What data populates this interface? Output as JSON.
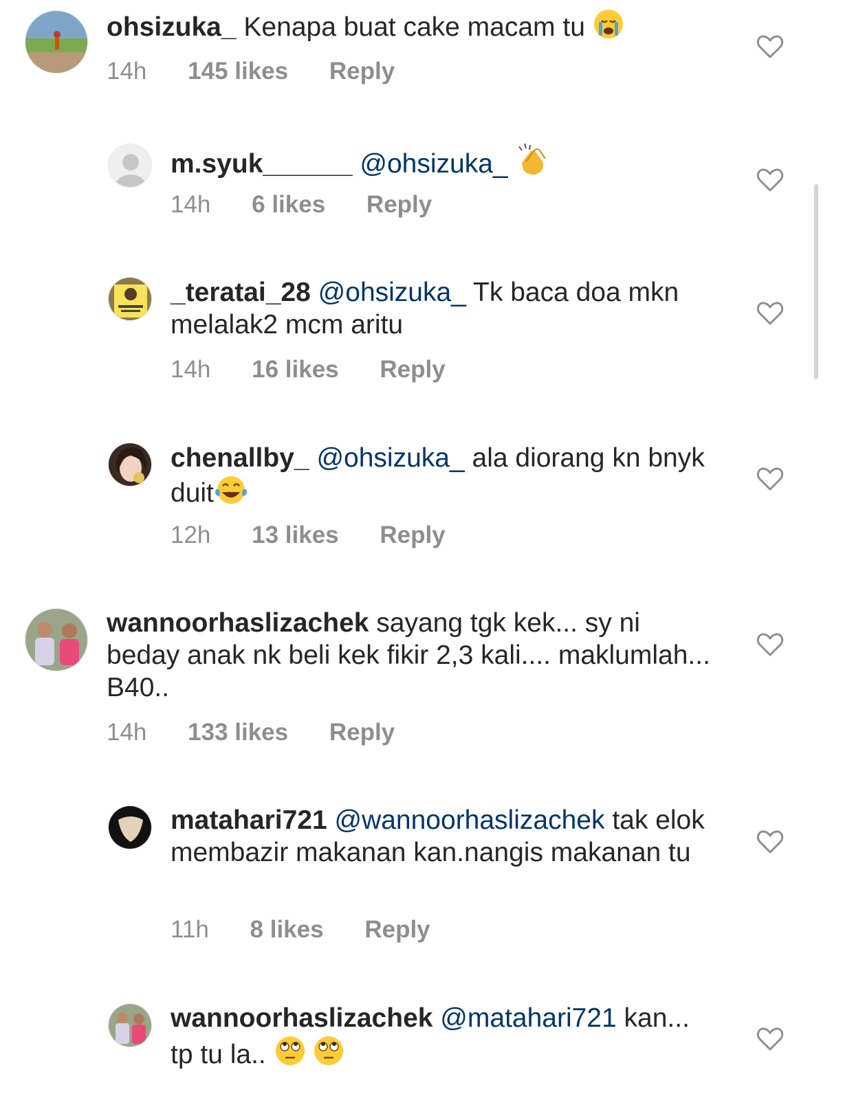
{
  "comments": [
    {
      "user": "ohsizuka_",
      "mention": "",
      "text": "Kenapa buat cake macam tu",
      "emoji": "crying-emoji",
      "time": "14h",
      "likes": "145 likes",
      "reply": "Reply"
    },
    {
      "user": "m.syuk______",
      "mention": "@ohsizuka_",
      "text": "",
      "emoji": "clapping-hands-emoji",
      "time": "14h",
      "likes": "6 likes",
      "reply": "Reply"
    },
    {
      "user": "_teratai_28",
      "mention": "@ohsizuka_",
      "text": "Tk baca doa mkn melalak2 mcm aritu",
      "emoji": "",
      "time": "14h",
      "likes": "16 likes",
      "reply": "Reply"
    },
    {
      "user": "chenallby_",
      "mention": "@ohsizuka_",
      "text": "ala diorang kn bnyk duit",
      "emoji": "tears-of-joy-emoji",
      "time": "12h",
      "likes": "13 likes",
      "reply": "Reply"
    },
    {
      "user": "wannoorhaslizachek",
      "mention": "",
      "text": "sayang tgk kek... sy ni beday anak nk beli kek fikir 2,3 kali.... maklumlah... B40..",
      "emoji": "",
      "time": "14h",
      "likes": "133 likes",
      "reply": "Reply"
    },
    {
      "user": "matahari721",
      "mention": "@wannoorhaslizachek",
      "text": "tak elok membazir makanan kan.nangis makanan tu",
      "emoji": "",
      "time": "11h",
      "likes": "8 likes",
      "reply": "Reply"
    },
    {
      "user": "wannoorhaslizachek",
      "mention": "@matahari721",
      "text": "kan... tp tu la..",
      "emoji": "eye-roll-emoji",
      "time": "",
      "likes": "",
      "reply": ""
    }
  ],
  "icons": {
    "heart": "heart-outline-icon"
  },
  "colors": {
    "text": "#262626",
    "meta": "#8e8e8e",
    "mention": "#003569"
  }
}
